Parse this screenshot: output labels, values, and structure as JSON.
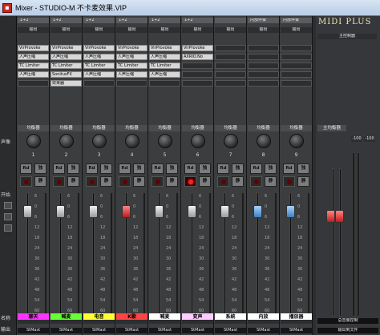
{
  "window": {
    "title": "Mixer - STUDIO-M 不卡麦效果.VIP"
  },
  "logo": "MIDI PLUS",
  "left_labels": {
    "pan": "声像",
    "on": "开始",
    "name": "名称",
    "output": "输出"
  },
  "colors": {
    "accent": "#c8281e",
    "bg": "#2c2e30"
  },
  "channels": [
    {
      "num": "1",
      "color": "#ff33ff",
      "name": "聊天",
      "route_in": "1+2",
      "route_out": "输出",
      "inserts": [
        "VirProvoke",
        "人声压缩",
        "TC Limiter",
        "人声压缩",
        ""
      ],
      "rec_on": false,
      "fader": "white",
      "out": "StMast"
    },
    {
      "num": "2",
      "color": "#66ff33",
      "name": "喊麦",
      "route_in": "1+2",
      "route_out": "输出",
      "inserts": [
        "VirProvoke",
        "人声压缩",
        "TC Limiter",
        "SonitusFX",
        "效果器"
      ],
      "rec_on": false,
      "fader": "white",
      "out": "StMast"
    },
    {
      "num": "3",
      "color": "#ffff33",
      "name": "电音",
      "route_in": "1+2",
      "route_out": "输出",
      "inserts": [
        "VirProvoke",
        "人声压缩",
        "TC Limiter",
        "人声压缩",
        ""
      ],
      "rec_on": false,
      "fader": "white",
      "out": "StMast"
    },
    {
      "num": "4",
      "color": "#ff4444",
      "name": "K歌",
      "route_in": "1+2",
      "route_out": "输出",
      "inserts": [
        "VirProvoke",
        "人声压缩",
        "TC Limiter",
        "人声压缩",
        ""
      ],
      "rec_on": false,
      "fader": "red",
      "out": "StMast"
    },
    {
      "num": "5",
      "color": "#ffffff",
      "name": "喊麦",
      "route_in": "1+2",
      "route_out": "输出",
      "inserts": [
        "VirProvoke",
        "人声压缩",
        "TC Limiter",
        "人声压缩",
        ""
      ],
      "rec_on": false,
      "fader": "white",
      "out": "StMast"
    },
    {
      "num": "6",
      "color": "#ffccff",
      "name": "变声",
      "route_in": "1+2",
      "route_out": "输出",
      "inserts": [
        "VirProvoke",
        "AXRIO.No",
        "",
        "",
        ""
      ],
      "rec_on": true,
      "fader": "white",
      "out": "StMast"
    },
    {
      "num": "7",
      "color": "#ffffff",
      "name": "系统",
      "route_in": "",
      "route_out": "输出",
      "inserts": [
        "",
        "",
        "",
        "",
        ""
      ],
      "rec_on": false,
      "fader": "white",
      "out": "StMast"
    },
    {
      "num": "8",
      "color": "#ffffff",
      "name": "内放",
      "route_in": "内部伴奏",
      "route_out": "输出",
      "inserts": [
        "",
        "",
        "",
        "",
        ""
      ],
      "rec_on": false,
      "fader": "blue",
      "out": "StMast"
    },
    {
      "num": "9",
      "color": "#ffffff",
      "name": "播放器",
      "route_in": "内部伴奏",
      "route_out": "输出",
      "inserts": [
        "",
        "",
        "",
        "",
        ""
      ],
      "rec_on": false,
      "fader": "blue",
      "out": "StMast"
    }
  ],
  "strip_labels": {
    "eq": "均衡器",
    "rec": "Rd",
    "solo": "独",
    "mute": "静"
  },
  "master": {
    "label": "主控制器",
    "eq": "主均衡器",
    "scale_l": "-100",
    "scale_r": "-100",
    "name": "总音量控制",
    "out": "输出到文件"
  },
  "scale": [
    "6",
    "0",
    "6",
    "12",
    "18",
    "24",
    "30",
    "36",
    "42",
    "48",
    "54",
    "60"
  ]
}
